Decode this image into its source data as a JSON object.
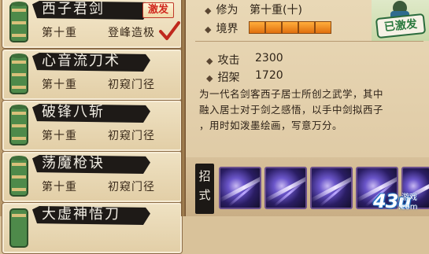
{
  "skills": [
    {
      "name": "西子君剑",
      "level": "第十重",
      "stage": "登峰造极",
      "badge": "激发",
      "selected": true
    },
    {
      "name": "心音流刀术",
      "level": "第十重",
      "stage": "初窥门径"
    },
    {
      "name": "破锋八斩",
      "level": "第十重",
      "stage": "初窥门径"
    },
    {
      "name": "荡魔枪诀",
      "level": "第十重",
      "stage": "初窥门径"
    },
    {
      "name": "大虚神悟刀"
    }
  ],
  "detail": {
    "cultivation_label": "修为",
    "cultivation_value": "第十重(十)",
    "realm_label": "境界",
    "realm_level": 5,
    "activated": "已激发",
    "attack_label": "攻击",
    "attack_value": "2300",
    "parry_label": "招架",
    "parry_value": "1720",
    "description": [
      "为一代名剑客西子居士所创之武学，其中",
      "融入居士对于剑之感悟，以手中剑拟西子",
      "，用时如泼墨绘画，写意万分。"
    ],
    "moves_label": [
      "招",
      "式"
    ]
  },
  "watermark": {
    "num": "43u",
    "sub1": "游戏",
    "sub2": ".com"
  },
  "colors": {
    "accent": "#d0281e",
    "realm": "#f08a1e",
    "activated": "#2b7a3f"
  }
}
